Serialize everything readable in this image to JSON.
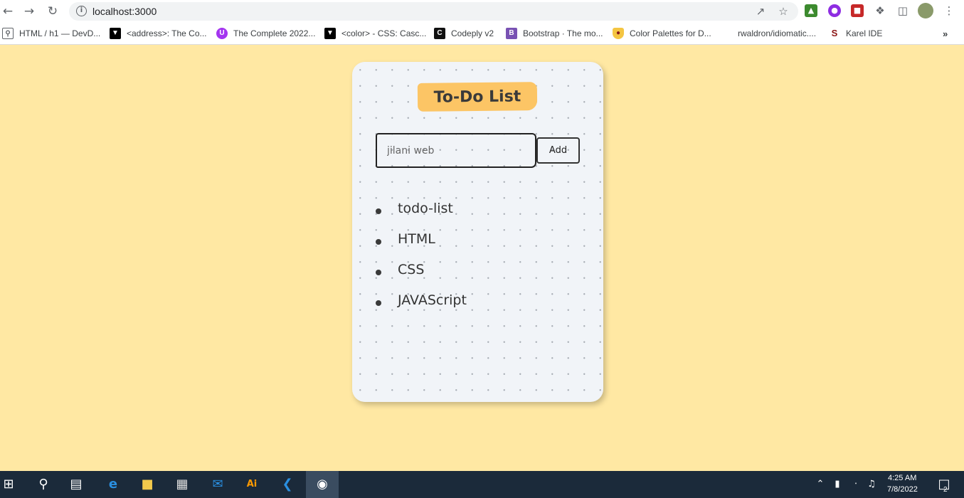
{
  "browser": {
    "url": "localhost:3000",
    "bookmarks": [
      {
        "label": "HTML / h1 — DevD...",
        "icon": "search-icon",
        "color": "#5f6368"
      },
      {
        "label": "<address>: The Co...",
        "icon": "mdn-icon",
        "color": "#000000"
      },
      {
        "label": "The Complete 2022...",
        "icon": "udemy-icon",
        "color": "#a435f0"
      },
      {
        "label": "<color> - CSS: Casc...",
        "icon": "mdn-icon",
        "color": "#000000"
      },
      {
        "label": "Codeply v2",
        "icon": "codeply-icon",
        "color": "#111111"
      },
      {
        "label": "Bootstrap · The mo...",
        "icon": "bootstrap-icon",
        "color": "#7952b3"
      },
      {
        "label": "Color Palettes for D...",
        "icon": "palette-icon",
        "color": "#d9a400"
      },
      {
        "label": "rwaldron/idiomatic....",
        "icon": "github-icon",
        "color": "#ffffff"
      },
      {
        "label": "Karel IDE",
        "icon": "stanford-icon",
        "color": "#8c1515"
      }
    ]
  },
  "app": {
    "title": "To-Do List",
    "input_value": "jilani web",
    "add_label": "Add",
    "items": [
      "todo-list",
      "HTML",
      "CSS",
      "JAVAScript"
    ]
  },
  "taskbar": {
    "time": "4:25 AM",
    "date": "7/8/2022",
    "notifications": "2"
  },
  "colors": {
    "page_background": "#ffe8a3",
    "title_badge": "#fcc565",
    "card_background": "#f1f4f8"
  }
}
